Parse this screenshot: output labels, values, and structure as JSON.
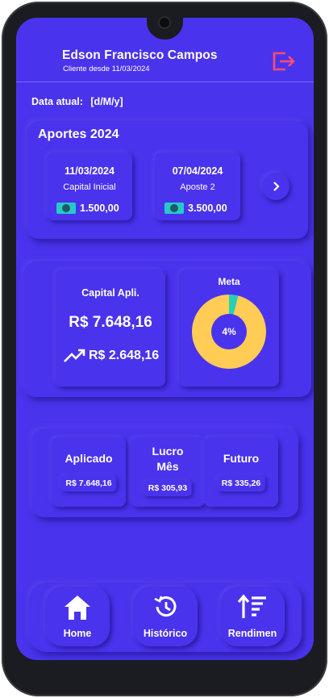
{
  "user": {
    "name": "Edson Francisco Campos",
    "since": "Cliente desde 11/03/2024"
  },
  "date": {
    "label": "Data atual:",
    "value": "[d/M/y]"
  },
  "aportes": {
    "title": "Aportes 2024",
    "items": [
      {
        "date": "11/03/2024",
        "description": "Capital Inicial",
        "amount": "1.500,00"
      },
      {
        "date": "07/04/2024",
        "description": "Aposte 2",
        "amount": "3.500,00"
      }
    ]
  },
  "capital": {
    "title": "Capital Apli.",
    "value": "R$ 7.648,16",
    "profit": "R$ 2.648,16"
  },
  "meta": {
    "title": "Meta",
    "percent_label": "4%",
    "percent": 4
  },
  "stats": [
    {
      "label": "Aplicado",
      "value": "R$ 7.648,16"
    },
    {
      "label": "Lucro Mês",
      "value": "R$ 305,93"
    },
    {
      "label": "Futuro",
      "value": "R$ 335,26"
    }
  ],
  "nav": [
    {
      "label": "Home",
      "icon": "home-icon"
    },
    {
      "label": "Histórico",
      "icon": "history-icon"
    },
    {
      "label": "Rendimen",
      "icon": "sort-icon"
    }
  ],
  "colors": {
    "background": "#4a33ec",
    "accent_logout": "#ff4d6d",
    "donut_fill": "#ffcc55",
    "donut_progress": "#26d0b8",
    "money": "#26c9c9"
  }
}
